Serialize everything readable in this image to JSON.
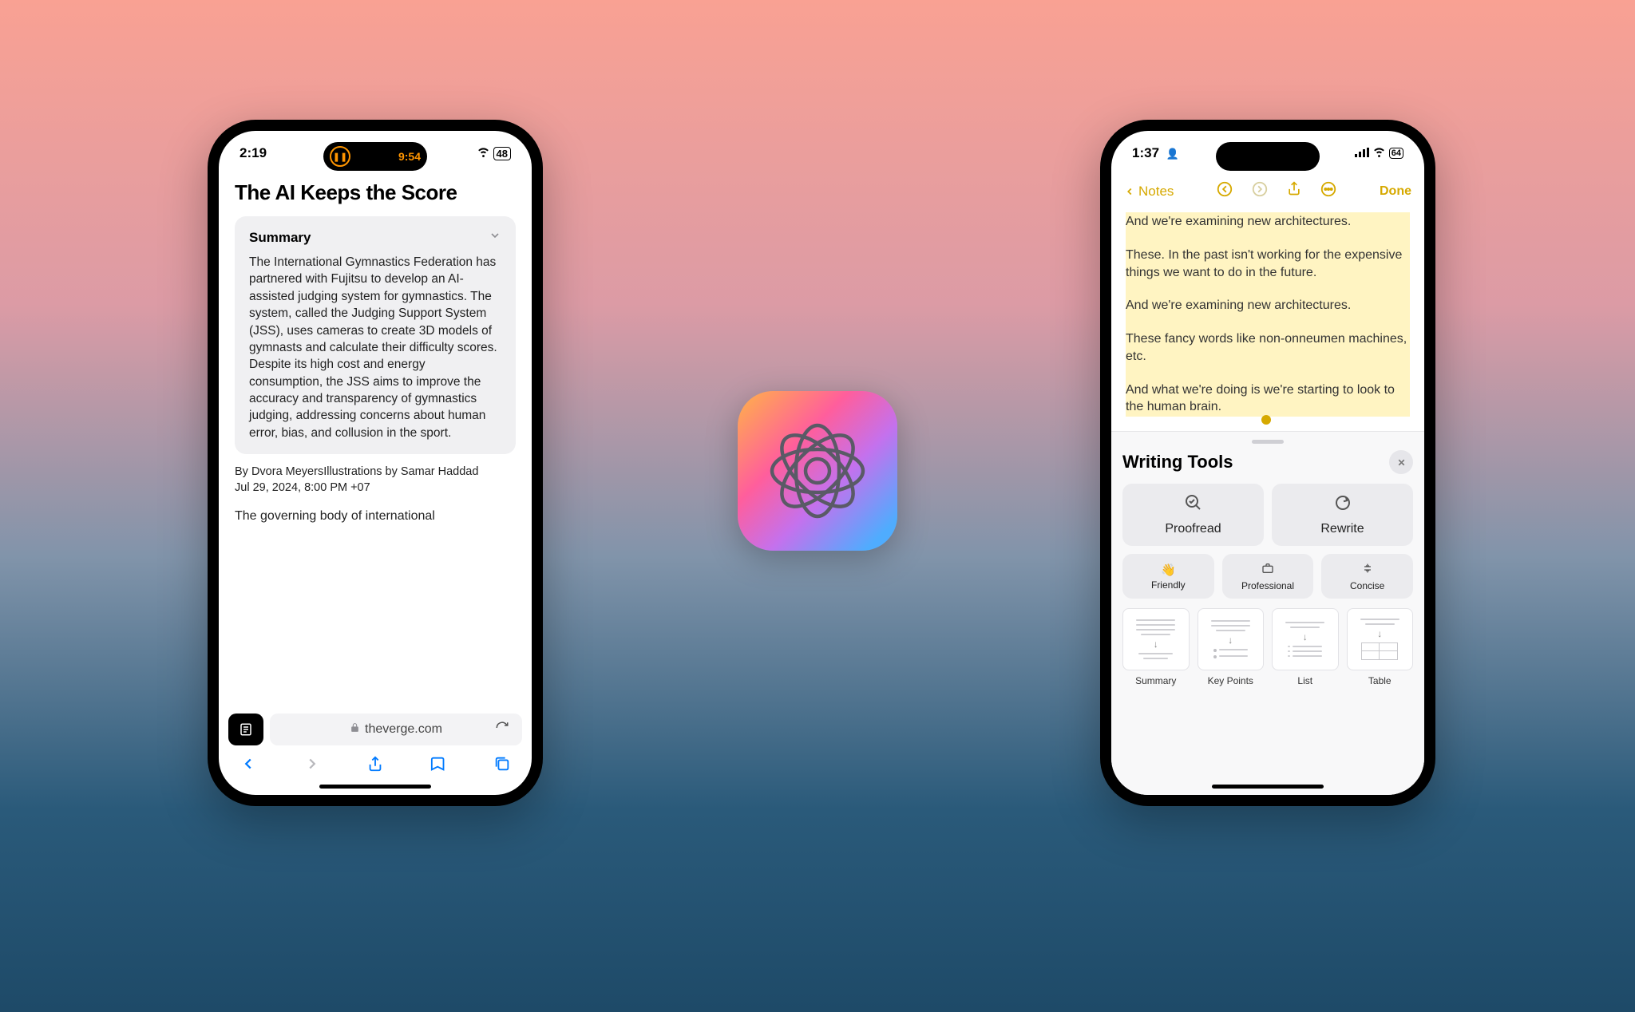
{
  "left_phone": {
    "status": {
      "time": "2:19",
      "pill_time": "9:54",
      "wifi": true,
      "battery": "48"
    },
    "article": {
      "title": "The AI Keeps the Score",
      "summary_label": "Summary",
      "summary_text": "The International Gymnastics Federation has partnered with Fujitsu to develop an AI-assisted judging system for gymnastics. The system, called the Judging Support System (JSS), uses cameras to create 3D models of gymnasts and calculate their difficulty scores. Despite its high cost and energy consumption, the JSS aims to improve the accuracy and transparency of gymnastics judging, addressing concerns about human error, bias, and collusion in the sport.",
      "byline": "By Dvora MeyersIllustrations by Samar Haddad",
      "dateline": "Jul 29, 2024, 8:00 PM +07",
      "body_preview": "The governing body of international"
    },
    "safari": {
      "url": "theverge.com",
      "back_enabled": true,
      "forward_enabled": false
    }
  },
  "center_icon": {
    "name": "apple-intelligence-icon"
  },
  "right_phone": {
    "status": {
      "time": "1:37",
      "battery": "64",
      "signal": true,
      "wifi": true
    },
    "nav": {
      "back_label": "Notes",
      "done_label": "Done"
    },
    "note_lines": [
      "And we're examining new architectures.",
      "",
      "These. In the past isn't working for the expensive things we want to do in the future.",
      "",
      "And we're examining new architectures.",
      "",
      "These fancy words like non-onneumen machines, etc.",
      "",
      "And what we're doing is we're starting to look to the human brain."
    ],
    "writing_tools": {
      "title": "Writing Tools",
      "primary": [
        {
          "label": "Proofread",
          "icon": "magnify-check"
        },
        {
          "label": "Rewrite",
          "icon": "arrow-cycle"
        }
      ],
      "tone": [
        {
          "label": "Friendly",
          "icon": "hand-wave"
        },
        {
          "label": "Professional",
          "icon": "briefcase"
        },
        {
          "label": "Concise",
          "icon": "compress"
        }
      ],
      "formats": [
        {
          "label": "Summary"
        },
        {
          "label": "Key Points"
        },
        {
          "label": "List"
        },
        {
          "label": "Table"
        }
      ]
    }
  }
}
